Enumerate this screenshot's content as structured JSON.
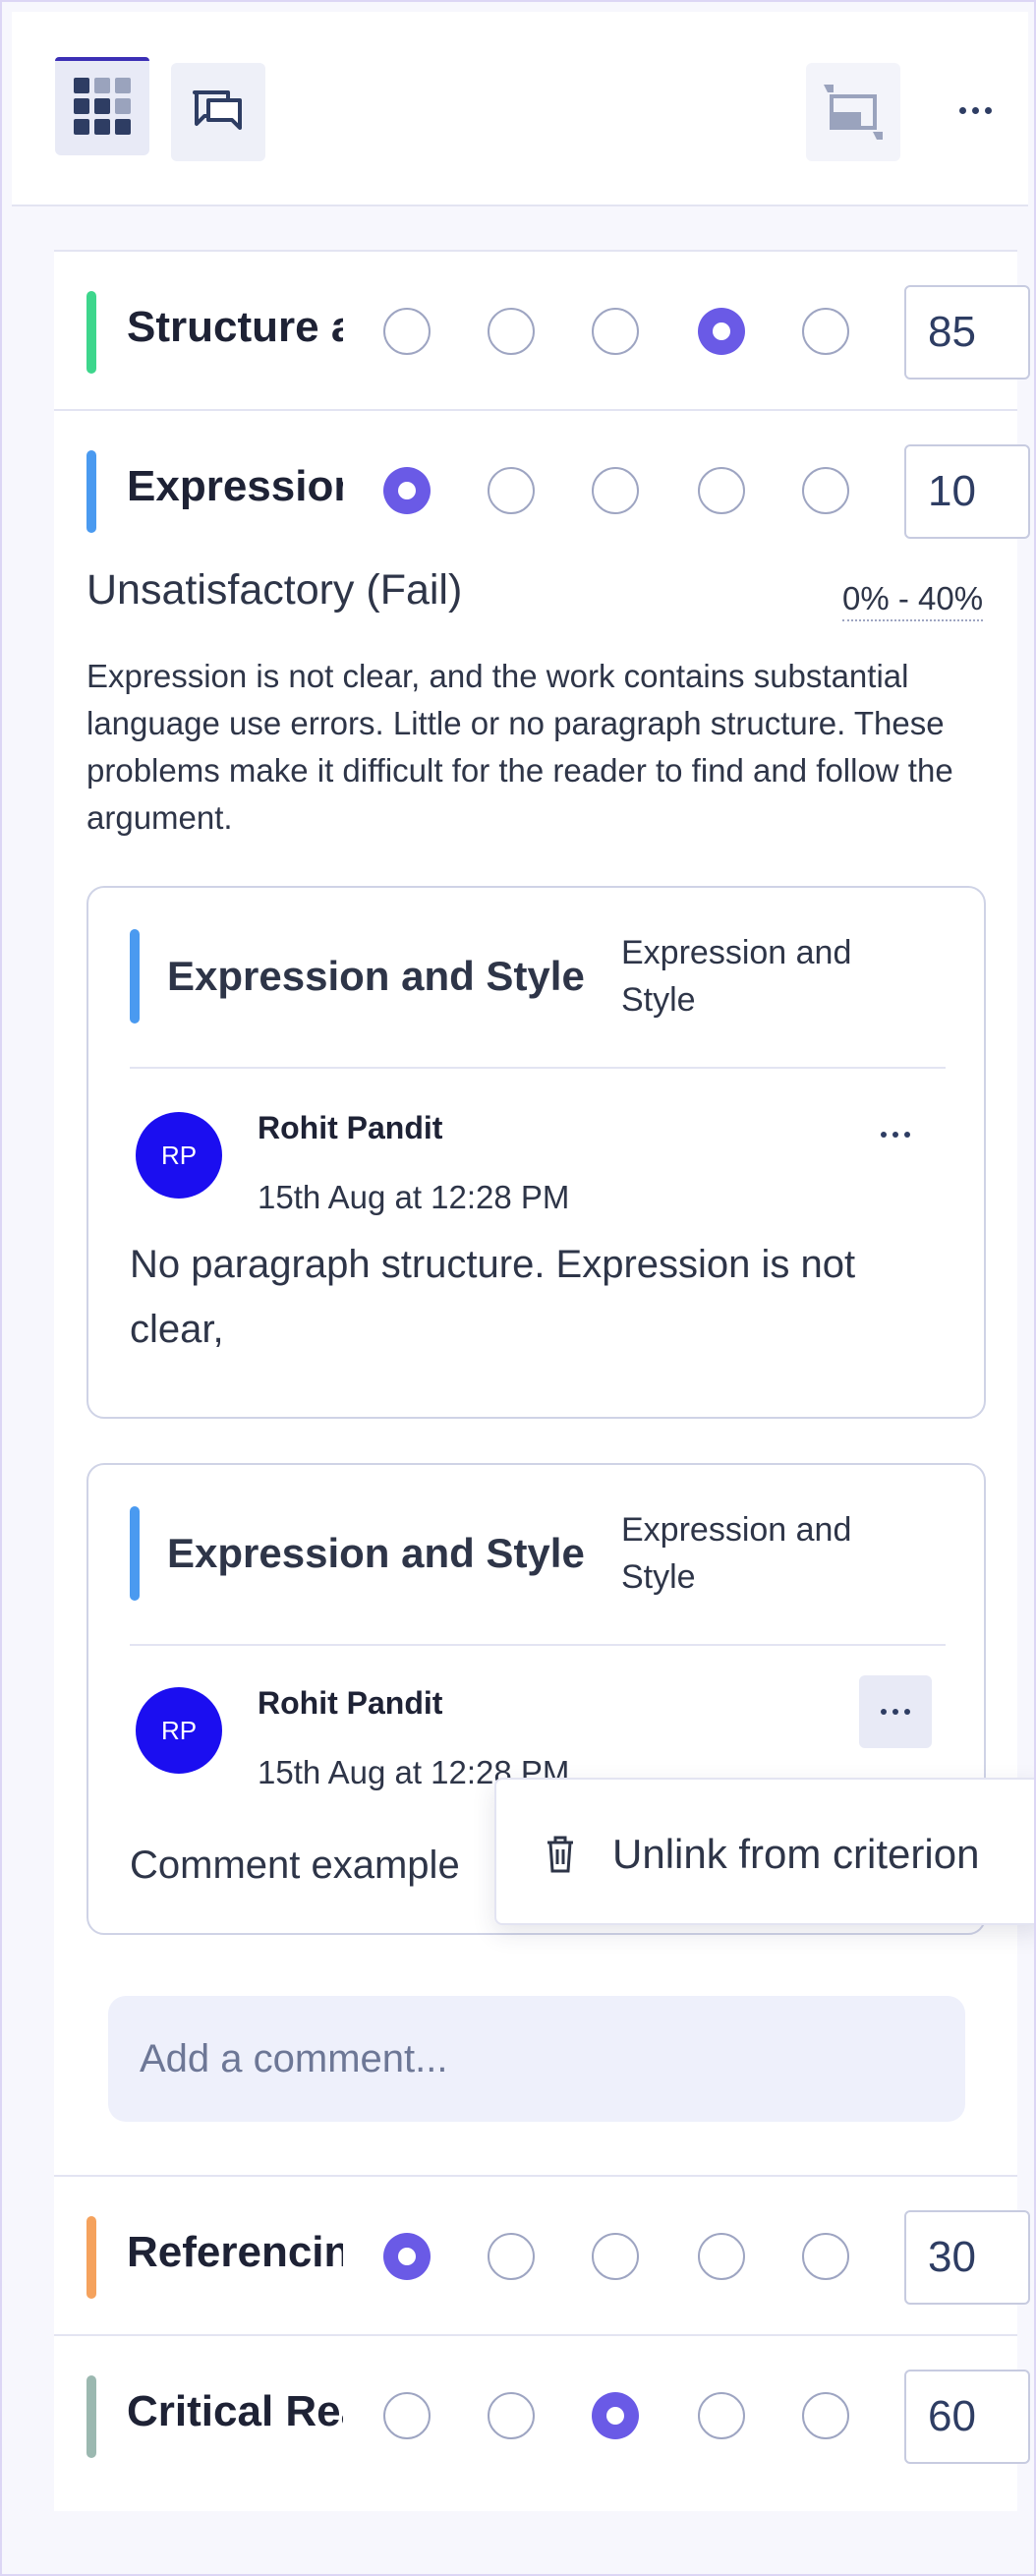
{
  "toolbar": {
    "grid_icon": "grid-icon",
    "chat_icon": "chat-icon",
    "image_icon": "image-quote-icon",
    "more_icon": "more-icon"
  },
  "criteria": [
    {
      "name": "Structure and Argument",
      "selected": 3,
      "score": "85",
      "color": "#3dd68c"
    },
    {
      "name": "Expression and Style",
      "selected": 0,
      "score": "10",
      "color": "#4a9af0"
    },
    {
      "name": "Referencing",
      "selected": 0,
      "score": "30",
      "color": "#f5a25d"
    },
    {
      "name": "Critical Reading",
      "selected": 2,
      "score": "60",
      "color": "#9bb8b0"
    }
  ],
  "level": {
    "title": "Unsatisfactory (Fail)",
    "range": "0% - 40%",
    "description": "Expression is not clear, and the work contains substantial language use errors. Little or no paragraph structure. These problems make it difficult for the reader to find and follow the argument."
  },
  "comments": [
    {
      "title": "Expression and Style",
      "subtitle": "Expression and Style",
      "initials": "RP",
      "author": "Rohit Pandit",
      "time": "15th Aug at 12:28 PM",
      "text": "No paragraph structure. Expression is not clear,"
    },
    {
      "title": "Expression and Style",
      "subtitle": "Expression and Style",
      "initials": "RP",
      "author": "Rohit Pandit",
      "time": "15th Aug at 12:28 PM",
      "text": "Comment example"
    }
  ],
  "menu": {
    "unlink_label": "Unlink from criterion",
    "unlink_icon": "trash-icon"
  },
  "add_comment": {
    "placeholder": "Add a comment..."
  }
}
